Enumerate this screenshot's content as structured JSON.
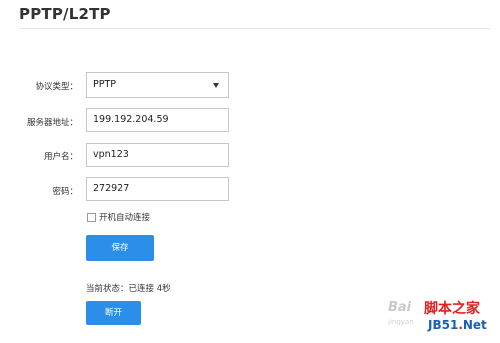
{
  "page": {
    "title": "PPTP/L2TP"
  },
  "form": {
    "protocol": {
      "label": "协议类型：",
      "value": "PPTP"
    },
    "server": {
      "label": "服务器地址：",
      "value": "199.192.204.59"
    },
    "username": {
      "label": "用户名：",
      "value": "vpn123"
    },
    "password": {
      "label": "密码：",
      "value": "272927"
    },
    "autoconnect": {
      "label": "开机自动连接",
      "checked": false
    },
    "save_label": "保存"
  },
  "status": {
    "text": "当前状态：已连接 4秒"
  },
  "disconnect_label": "断开",
  "watermark": {
    "baidu": "Bai",
    "baidu_sub": "jingyan",
    "site_name": "脚本之家",
    "url_prefix": "JB51",
    "url_dot": ".",
    "url_suffix": "Net"
  },
  "colors": {
    "accent": "#2b8ee9",
    "text": "#333333",
    "border": "#c8c8c8"
  }
}
